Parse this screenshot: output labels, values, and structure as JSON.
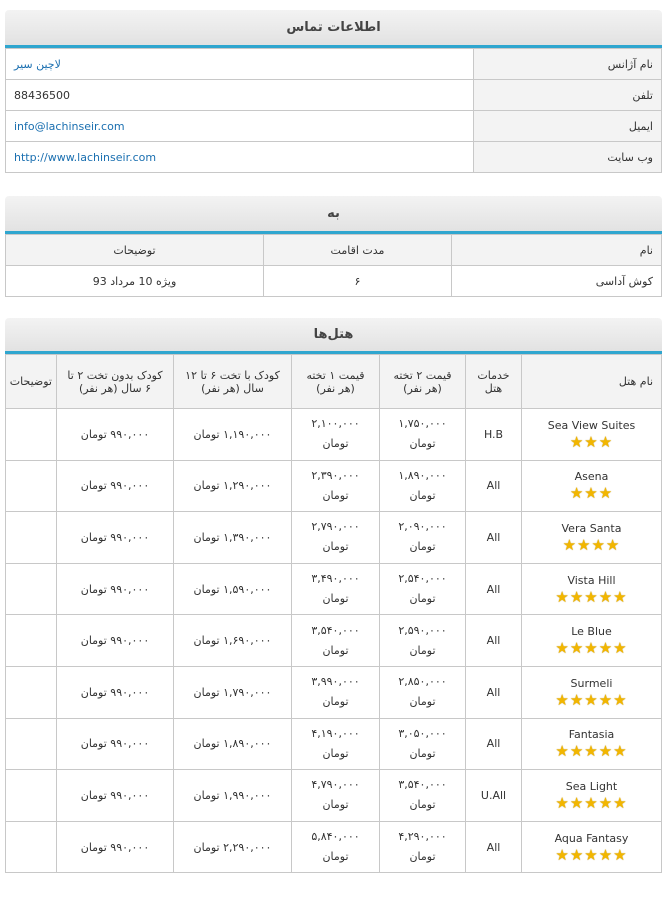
{
  "contact": {
    "title": "اطلاعات تماس",
    "rows": [
      {
        "label": "نام آژانس",
        "value": "لاچین سیر"
      },
      {
        "label": "تلفن",
        "value": "88436500"
      },
      {
        "label": "ایمیل",
        "value": "info@lachinseir.com"
      },
      {
        "label": "وب سایت",
        "value": "http://www.lachinseir.com"
      }
    ]
  },
  "destination": {
    "title": "به",
    "headers": [
      "نام",
      "مدت اقامت",
      "توضیحات"
    ],
    "row": {
      "name": "کوش آداسی",
      "stay": "۶",
      "notes": "ویژه 10 مرداد 93"
    }
  },
  "hotels": {
    "title": "هتل‌ها",
    "headers": [
      "نام هتل",
      "خدمات هتل",
      "قیمت ۲ تخته (هر نفر)",
      "قیمت ۱ تخته (هر نفر)",
      "کودک با تخت ۶ تا ۱۲ سال (هر نفر)",
      "کودک بدون تخت ۲ تا ۶ سال (هر نفر)",
      "توضیحات"
    ],
    "currency": "تومان",
    "rows": [
      {
        "name": "Sea View Suites",
        "stars": 3,
        "service": "H.B",
        "double": "۱,۷۵۰,۰۰۰",
        "single": "۲,۱۰۰,۰۰۰",
        "child_bed": "۱,۱۹۰,۰۰۰ تومان",
        "child_nobed": "۹۹۰,۰۰۰ تومان",
        "notes": ""
      },
      {
        "name": "Asena",
        "stars": 3,
        "service": "All",
        "double": "۱,۸۹۰,۰۰۰",
        "single": "۲,۳۹۰,۰۰۰",
        "child_bed": "۱,۲۹۰,۰۰۰ تومان",
        "child_nobed": "۹۹۰,۰۰۰ تومان",
        "notes": ""
      },
      {
        "name": "Vera Santa",
        "stars": 4,
        "service": "All",
        "double": "۲,۰۹۰,۰۰۰",
        "single": "۲,۷۹۰,۰۰۰",
        "child_bed": "۱,۳۹۰,۰۰۰ تومان",
        "child_nobed": "۹۹۰,۰۰۰ تومان",
        "notes": ""
      },
      {
        "name": "Vista Hill",
        "stars": 5,
        "service": "All",
        "double": "۲,۵۴۰,۰۰۰",
        "single": "۳,۴۹۰,۰۰۰",
        "child_bed": "۱,۵۹۰,۰۰۰ تومان",
        "child_nobed": "۹۹۰,۰۰۰ تومان",
        "notes": ""
      },
      {
        "name": "Le Blue",
        "stars": 5,
        "service": "All",
        "double": "۲,۵۹۰,۰۰۰",
        "single": "۳,۵۴۰,۰۰۰",
        "child_bed": "۱,۶۹۰,۰۰۰ تومان",
        "child_nobed": "۹۹۰,۰۰۰ تومان",
        "notes": ""
      },
      {
        "name": "Surmeli",
        "stars": 5,
        "service": "All",
        "double": "۲,۸۵۰,۰۰۰",
        "single": "۳,۹۹۰,۰۰۰",
        "child_bed": "۱,۷۹۰,۰۰۰ تومان",
        "child_nobed": "۹۹۰,۰۰۰ تومان",
        "notes": ""
      },
      {
        "name": "Fantasia",
        "stars": 5,
        "service": "All",
        "double": "۳,۰۵۰,۰۰۰",
        "single": "۴,۱۹۰,۰۰۰",
        "child_bed": "۱,۸۹۰,۰۰۰ تومان",
        "child_nobed": "۹۹۰,۰۰۰ تومان",
        "notes": ""
      },
      {
        "name": "Sea Light",
        "stars": 5,
        "service": "U.All",
        "double": "۳,۵۴۰,۰۰۰",
        "single": "۴,۷۹۰,۰۰۰",
        "child_bed": "۱,۹۹۰,۰۰۰ تومان",
        "child_nobed": "۹۹۰,۰۰۰ تومان",
        "notes": ""
      },
      {
        "name": "Aqua Fantasy",
        "stars": 5,
        "service": "All",
        "double": "۴,۲۹۰,۰۰۰",
        "single": "۵,۸۴۰,۰۰۰",
        "child_bed": "۲,۲۹۰,۰۰۰ تومان",
        "child_nobed": "۹۹۰,۰۰۰ تومان",
        "notes": ""
      }
    ]
  }
}
